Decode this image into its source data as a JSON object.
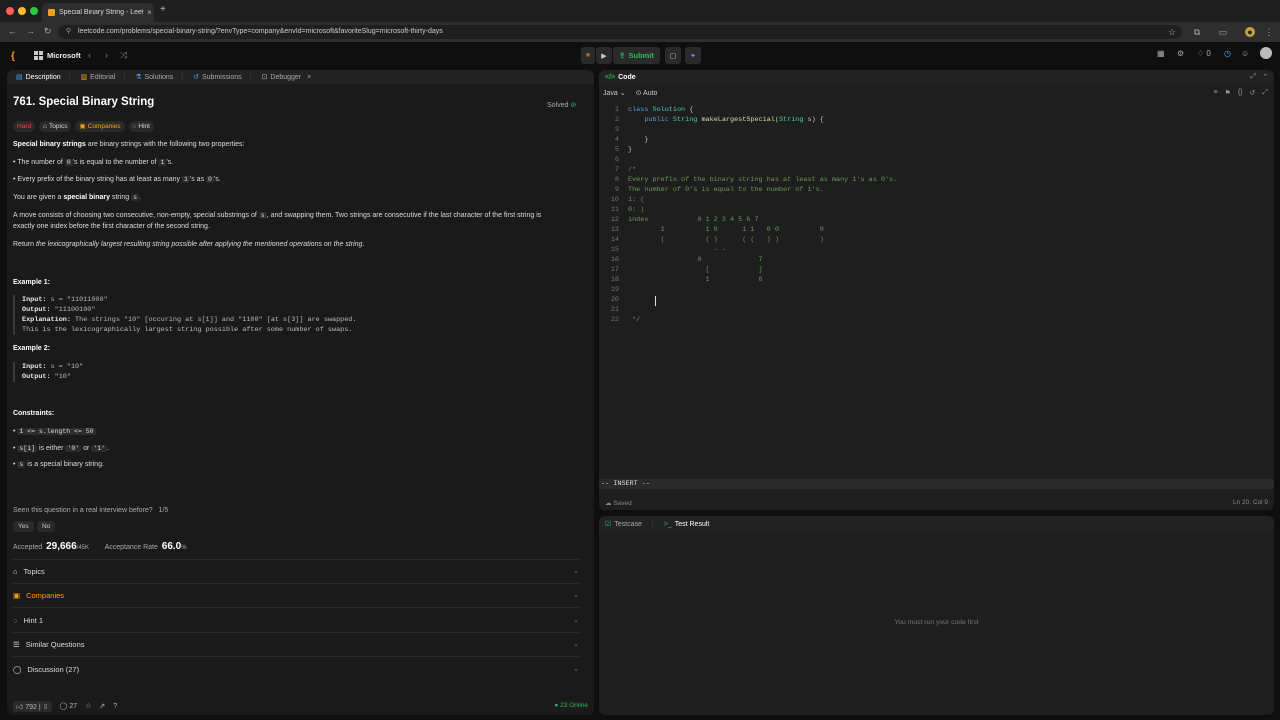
{
  "browser": {
    "tab_title": "Special Binary String - LeetC",
    "url": "leetcode.com/problems/special-binary-string/?envType=company&envId=microsoft&favoriteSlug=microsoft-thirty-days"
  },
  "nav": {
    "list_name": "Microsoft",
    "submit_label": "Submit",
    "streak": "0"
  },
  "left_tabs": [
    "Description",
    "Editorial",
    "Solutions",
    "Submissions",
    "Debugger"
  ],
  "problem": {
    "title": "761. Special Binary String",
    "status": "Solved",
    "difficulty": "Hard",
    "tag_topics": "Topics",
    "tag_companies": "Companies",
    "tag_hint": "Hint",
    "intro_bold": "Special binary strings",
    "intro_rest": " are binary strings with the following two properties:",
    "prop1_a": "The number of ",
    "prop1_c1": "0",
    "prop1_b": "'s is equal to the number of ",
    "prop1_c2": "1",
    "prop1_d": "'s.",
    "prop2_a": "Every prefix of the binary string has at least as many ",
    "prop2_c1": "1",
    "prop2_b": "'s as ",
    "prop2_c2": "0",
    "prop2_d": "'s.",
    "given_a": "You are given a ",
    "given_b": "special binary",
    "given_c": " string ",
    "given_code": "s",
    "given_d": ".",
    "move_1a": "A move consists of choosing two consecutive, non-empty, special substrings of ",
    "move_1code": "s",
    "move_1b": ", and swapping them. Two strings are consecutive if the last character of the first string is",
    "move_2": "exactly one index before the first character of the second string.",
    "return_a": "Return ",
    "return_b": "the lexicographically largest resulting string possible after applying the mentioned operations on the string",
    "return_c": ".",
    "ex1_title": "Example 1:",
    "ex1_input_label": "Input:",
    "ex1_input": " s = \"11011000\"",
    "ex1_output_label": "Output:",
    "ex1_output": " \"11100100\"",
    "ex1_expl_label": "Explanation:",
    "ex1_expl": " The strings \"10\" [occuring at s[1]] and \"1100\" [at s[3]] are swapped.",
    "ex1_expl2": "This is the lexicographically largest string possible after some number of swaps.",
    "ex2_title": "Example 2:",
    "ex2_input_label": "Input:",
    "ex2_input": " s = \"10\"",
    "ex2_output_label": "Output:",
    "ex2_output": " \"10\"",
    "constraints_title": "Constraints:",
    "c1": "1 <= s.length <= 50",
    "c2_code": "s[i]",
    "c2_a": " is either ",
    "c2_code2": "'0'",
    "c2_b": " or ",
    "c2_code3": "'1'",
    "c2_c": ".",
    "c3_code": "s",
    "c3_rest": " is a special binary string.",
    "seen_question": "Seen this question in a real interview before?",
    "seen_count": "1/5",
    "yes": "Yes",
    "no": "No",
    "accepted_label": "Accepted",
    "accepted_value": "29,666",
    "accepted_total": "/45K",
    "rate_label": "Acceptance Rate",
    "rate_value": "66.0",
    "rate_unit": "%",
    "sections": [
      "Topics",
      "Companies",
      "Hint 1",
      "Similar Questions",
      "Discussion (27)"
    ],
    "likes": "792",
    "comments": "27",
    "online": "23 Online"
  },
  "code": {
    "header": "Code",
    "language": "Java",
    "mode": "Auto",
    "mode_line": "-- INSERT --",
    "saved": "Saved",
    "position": "Ln 20, Col 9",
    "lines": [
      {
        "n": "1",
        "parts": [
          [
            "kw",
            "class "
          ],
          [
            "ty",
            "Solution"
          ],
          [
            "",
            " {"
          ]
        ]
      },
      {
        "n": "2",
        "parts": [
          [
            "",
            "    "
          ],
          [
            "kw",
            "public "
          ],
          [
            "ty",
            "String "
          ],
          [
            "fn",
            "makeLargestSpecial"
          ],
          [
            "",
            "("
          ],
          [
            "ty",
            "String"
          ],
          [
            "",
            " s) {"
          ]
        ]
      },
      {
        "n": "3",
        "parts": [
          [
            "",
            ""
          ]
        ]
      },
      {
        "n": "4",
        "parts": [
          [
            "",
            "    }"
          ]
        ]
      },
      {
        "n": "5",
        "parts": [
          [
            "",
            "}"
          ]
        ]
      },
      {
        "n": "6",
        "parts": [
          [
            "",
            ""
          ]
        ]
      },
      {
        "n": "7",
        "parts": [
          [
            "cm",
            "/*"
          ]
        ]
      },
      {
        "n": "8",
        "parts": [
          [
            "cm",
            "Every prefix of the binary string has at least as many 1's as 0's."
          ]
        ]
      },
      {
        "n": "9",
        "parts": [
          [
            "cm",
            "The number of 0's is equal to the number of 1's."
          ]
        ]
      },
      {
        "n": "10",
        "parts": [
          [
            "cm",
            "1: ("
          ]
        ]
      },
      {
        "n": "11",
        "parts": [
          [
            "cm",
            "0: )"
          ]
        ]
      },
      {
        "n": "12",
        "parts": [
          [
            "cm",
            "index            0 1 2 3 4 5 6 7"
          ]
        ]
      },
      {
        "n": "13",
        "parts": [
          [
            "cm",
            "        1          1 0      1 1   0 0          0"
          ]
        ]
      },
      {
        "n": "14",
        "parts": [
          [
            "cm",
            "        (          ( )      ( (   ) )          )"
          ]
        ]
      },
      {
        "n": "15",
        "parts": [
          [
            "cm",
            "                     - -"
          ]
        ]
      },
      {
        "n": "16",
        "parts": [
          [
            "cm",
            "                 0              7"
          ]
        ]
      },
      {
        "n": "17",
        "parts": [
          [
            "cm",
            "                   [            ]"
          ]
        ]
      },
      {
        "n": "18",
        "parts": [
          [
            "cm",
            "                   1            6"
          ]
        ]
      },
      {
        "n": "19",
        "parts": [
          [
            "",
            ""
          ]
        ]
      },
      {
        "n": "20",
        "parts": [
          [
            "",
            ""
          ]
        ]
      },
      {
        "n": "21",
        "parts": [
          [
            "",
            ""
          ]
        ]
      },
      {
        "n": "22",
        "parts": [
          [
            "cm",
            " */"
          ]
        ]
      }
    ]
  },
  "tests": {
    "tab_testcase": "Testcase",
    "tab_result": "Test Result",
    "message": "You must run your code first"
  }
}
